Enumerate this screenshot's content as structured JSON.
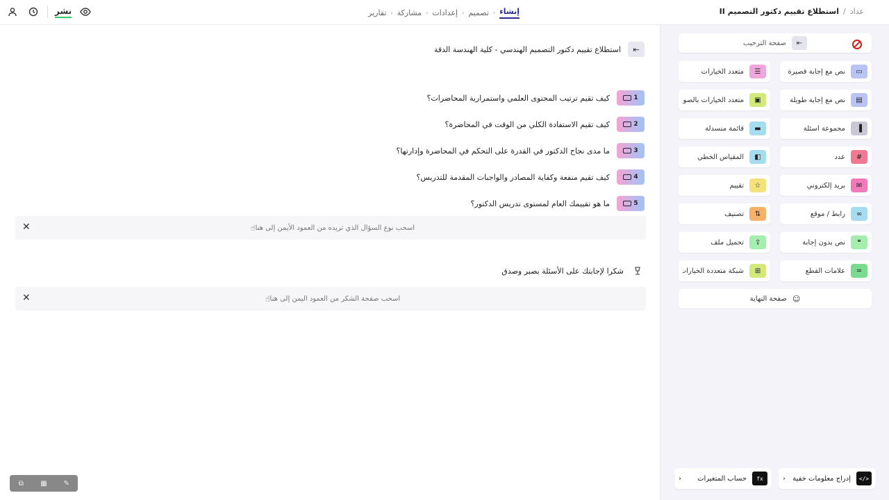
{
  "header": {
    "breadcrumb_home": "عداد",
    "breadcrumb_sep": "/",
    "form_title": "استطلاع تقييم دكتور التصميم II",
    "tabs": [
      {
        "label": "إنشاء",
        "active": true
      },
      {
        "label": "تصميم",
        "active": false
      },
      {
        "label": "إعدادات",
        "active": false
      },
      {
        "label": "مشاركة",
        "active": false
      },
      {
        "label": "تقارير",
        "active": false
      }
    ],
    "publish_label": "نشر"
  },
  "main": {
    "form_heading": "استطلاع تقييم دكتور التصميم الهندسي - كلية الهندسة الدقة",
    "questions": [
      {
        "num": "1",
        "text": "كيف تقيم ترتيب المحتوى العلمي واستمرارية المحاضرات؟"
      },
      {
        "num": "2",
        "text": "كيف تقيم الاستفادة الكلي من الوقت في المحاضرة؟"
      },
      {
        "num": "3",
        "text": "ما مدى نجاح الدكتور في القدرة على التحكم في المحاضرة وإدارتها؟"
      },
      {
        "num": "4",
        "text": "كيف تقيم منفعة وكفاية المصادر والواجبات المقدمة للتدريس؟"
      },
      {
        "num": "5",
        "text": "ما هو تقييمك العام لمستوى تدريس الدكتور؟"
      }
    ],
    "dropzone_questions": "اسحب نوع السؤال الذي تريده من العمود الأيمن إلى هنا",
    "end_note": "شكرا لإجابتك على الأسئلة بصبر وصدق",
    "dropzone_thanks": "اسحب صفحة الشكر من العمود اليمن إلى هنا"
  },
  "sidebar": {
    "welcome_label": "صفحة الترحيب",
    "fields": [
      {
        "label": "نص مع إجابة قصيرة",
        "icon": "short-text-icon",
        "color": "#b9c4f5"
      },
      {
        "label": "متعدد الخيارات",
        "icon": "multiple-choice-icon",
        "color": "#f0a6dc"
      },
      {
        "label": "نص مع إجابة طويلة",
        "icon": "long-text-icon",
        "color": "#b9c4f5"
      },
      {
        "label": "متعدد الخيارات بالصور",
        "icon": "image-choice-icon",
        "color": "#d2ea7a"
      },
      {
        "label": "مجموعة أسئلة",
        "icon": "question-group-icon",
        "color": "#c9c9d6"
      },
      {
        "label": "قائمة منسدلة",
        "icon": "dropdown-icon",
        "color": "#a6dcf0"
      },
      {
        "label": "عدد",
        "icon": "number-icon",
        "color": "#f07a94"
      },
      {
        "label": "المقياس الخطي",
        "icon": "linear-scale-icon",
        "color": "#a6dcf0"
      },
      {
        "label": "بريد إلكتروني",
        "icon": "email-icon",
        "color": "#f07aba"
      },
      {
        "label": "تقييم",
        "icon": "star-icon",
        "color": "#f5e27a"
      },
      {
        "label": "رابط / موقع",
        "icon": "link-icon",
        "color": "#a6dcf0"
      },
      {
        "label": "تصنيف",
        "icon": "ranking-icon",
        "color": "#f5b36a"
      },
      {
        "label": "نص بدون إجابة",
        "icon": "statement-icon",
        "color": "#a6eeb0"
      },
      {
        "label": "تحميل ملف",
        "icon": "file-upload-icon",
        "color": "#a6eeb0"
      },
      {
        "label": "علامات القطع",
        "icon": "divider-icon",
        "color": "#7adb8f"
      },
      {
        "label": "شبكة متعددة الخيارات",
        "icon": "matrix-icon",
        "color": "#d2ea7a"
      }
    ],
    "thanks_label": "صفحة النهاية",
    "bottom": [
      {
        "label": "إدراج معلومات خفية",
        "icon_text": "</>"
      },
      {
        "label": "حساب المتغيرات",
        "icon_text": "fx"
      }
    ]
  }
}
